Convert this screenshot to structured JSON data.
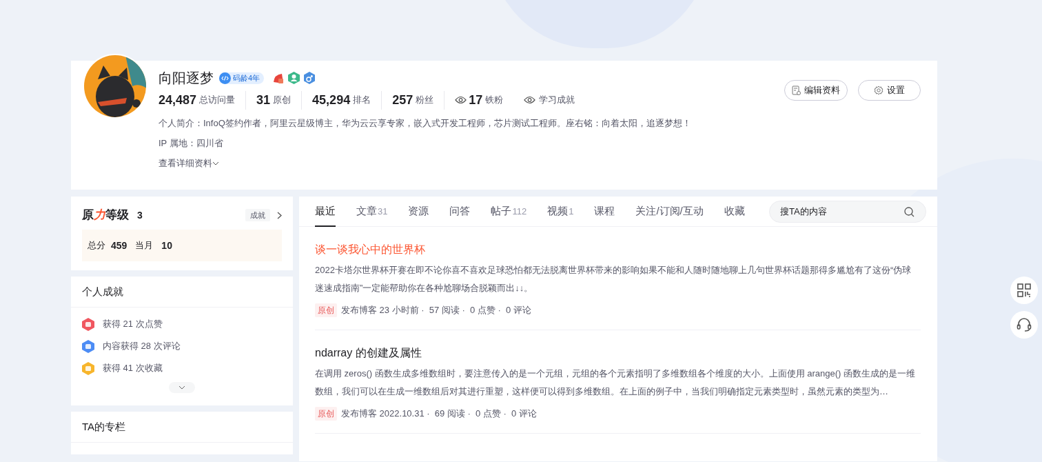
{
  "profile": {
    "name": "向阳逐梦",
    "code_age": "码龄4年",
    "stats": [
      {
        "kind": "count",
        "value": "24,487",
        "label": "总访问量"
      },
      {
        "kind": "count",
        "value": "31",
        "label": "原创"
      },
      {
        "kind": "count",
        "value": "45,294",
        "label": "排名"
      },
      {
        "kind": "count",
        "value": "257",
        "label": "粉丝"
      },
      {
        "kind": "eye",
        "value": "17",
        "label": "铁粉"
      },
      {
        "kind": "link",
        "label": "学习成就"
      }
    ],
    "bio": "个人简介：InfoQ签约作者，阿里云星级博主，华为云云享专家，嵌入式开发工程师，芯片测试工程师。座右铭：向着太阳，追逐梦想！",
    "ip": "IP 属地：四川省",
    "more": "查看详细资料",
    "buttons": [
      {
        "kind": "edit",
        "label": "编辑资料"
      },
      {
        "kind": "settings",
        "label": "设置"
      }
    ]
  },
  "level": {
    "title": [
      {
        "text": "原",
        "accent": false
      },
      {
        "text": "力",
        "accent": true
      },
      {
        "text": "等级",
        "accent": false
      }
    ],
    "value": "3",
    "achievement_button": "成就",
    "total_label": "总分",
    "total": "459",
    "month_label": "当月",
    "month": "10"
  },
  "achievements": {
    "title": "个人成就",
    "items": [
      {
        "text": "获得 21 次点赞",
        "color": "#f0565f"
      },
      {
        "text": "内容获得 28 次评论",
        "color": "#4c8cf5"
      },
      {
        "text": "获得 41 次收藏",
        "color": "#f7b52c"
      }
    ]
  },
  "columns": {
    "title": "TA的专栏"
  },
  "tabs": [
    {
      "label": "最近",
      "selected": true
    },
    {
      "label": "文章",
      "count": "31",
      "selected": false
    },
    {
      "label": "资源",
      "selected": false
    },
    {
      "label": "问答",
      "selected": false
    },
    {
      "label": "帖子",
      "count": "112",
      "selected": false
    },
    {
      "label": "视频",
      "count": "1",
      "selected": false
    },
    {
      "label": "课程",
      "selected": false
    },
    {
      "label": "关注/订阅/互动",
      "selected": false
    },
    {
      "label": "收藏",
      "selected": false
    }
  ],
  "search": {
    "placeholder": "搜TA的内容"
  },
  "articles": [
    {
      "title": "谈一谈我心中的世界杯",
      "highlighted": true,
      "summary": "2022卡塔尔世界杯开赛在即不论你喜不喜欢足球恐怕都无法脱离世界杯带来的影响如果不能和人随时随地聊上几句世界杯话题那得多尴尬有了这份“伪球迷速成指南”一定能帮助你在各种尬聊场合脱颖而出↓↓。",
      "badge": "原创",
      "meta": "发布博客 23 小时前 ·  57 阅读 ·  0 点赞 ·  0 评论"
    },
    {
      "title": "ndarray 的创建及属性",
      "highlighted": false,
      "summary": "在调用 zeros() 函数生成多维数组时，要注意传入的是一个元组，元组的各个元素指明了多维数组各个维度的大小。上面使用 arange() 函数生成的是一维数组，我们可以在生成一维数组后对其进行重塑，这样便可以得到多维数组。在上面的例子中，当我们明确指定元素类型时，虽然元素的类型为…",
      "badge": "原创",
      "meta": "发布博客 2022.10.31 ·  69 阅读 ·  0 点赞 ·  0 评论"
    }
  ]
}
